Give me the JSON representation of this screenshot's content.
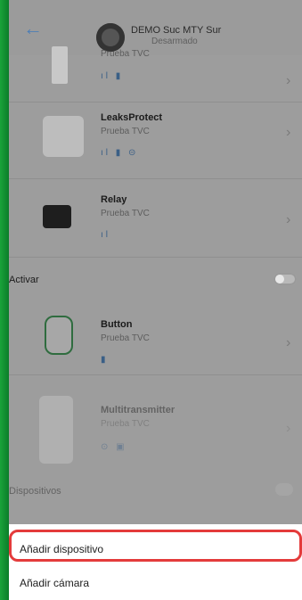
{
  "header": {
    "site_name": "DEMO Suc MTY Sur",
    "site_status": "Desarmado",
    "back_label": "←"
  },
  "list": [
    {
      "title": "",
      "subtitle": "Prueba TVC",
      "icons": "ıl ▮"
    },
    {
      "title": "LeaksProtect",
      "subtitle": "Prueba TVC",
      "icons": "ıl ▮ ⊝"
    },
    {
      "title": "Relay",
      "subtitle": "Prueba TVC",
      "icons": "ıl"
    }
  ],
  "section": {
    "label": "Activar"
  },
  "list2": [
    {
      "title": "Button",
      "subtitle": "Prueba TVC",
      "icons": "▮"
    },
    {
      "title": "Multitransmitter",
      "subtitle": "Prueba TVC",
      "icons": "⊙ ▣"
    }
  ],
  "footer_section": {
    "label": "Dispositivos"
  },
  "sheet": {
    "add_device": "Añadir dispositivo",
    "add_camera": "Añadir cámara"
  },
  "colors": {
    "highlight": "#e43b3b",
    "accent": "#4e7fb5",
    "edge_green": "#1aa33a"
  }
}
